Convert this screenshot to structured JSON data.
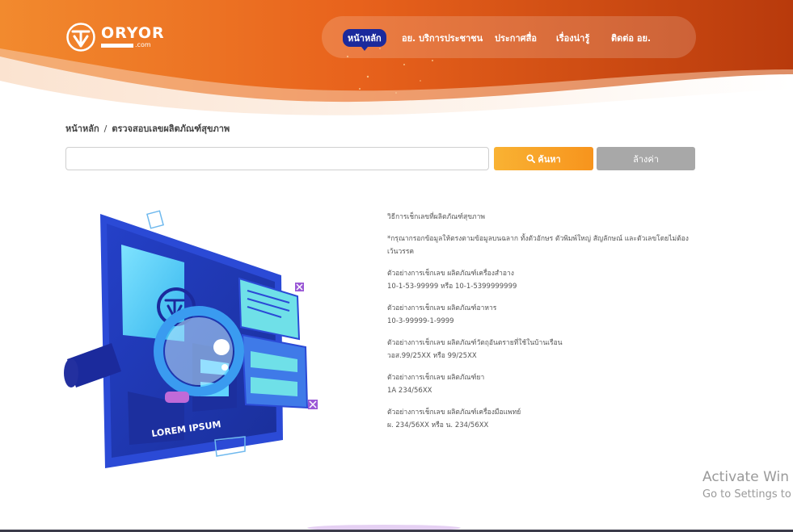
{
  "header": {
    "logo": {
      "name": "ORYOR",
      "sub": ".com",
      "icon": "fda-shield-icon"
    },
    "nav": [
      {
        "label": "หน้าหลัก",
        "active": true
      },
      {
        "label": "อย. บริการประชาชน",
        "active": false
      },
      {
        "label": "ประกาศสื่อ",
        "active": false
      },
      {
        "label": "เรื่องน่ารู้",
        "active": false
      },
      {
        "label": "ติดต่อ อย.",
        "active": false
      }
    ]
  },
  "breadcrumb": {
    "home": "หน้าหลัก",
    "separator": "/",
    "current": "ตรวจสอบเลขผลิตภัณฑ์สุขภาพ"
  },
  "search": {
    "value": "",
    "placeholder": "",
    "search_label": "ค้นหา",
    "search_icon": "search-icon",
    "clear_label": "ล้างค่า"
  },
  "illustration": {
    "caption": "LOREM IPSUM"
  },
  "instructions": {
    "title": "วิธีการเช็กเลขที่ผลิตภัณฑ์สุขภาพ",
    "note": "*กรุณากรอกข้อมูลให้ตรงตามข้อมูลบนฉลาก ทั้งตัวอักษร ตัวพิมพ์ใหญ่ สัญลักษณ์ และตัวเลขโดยไม่ต้องเว้นวรรค",
    "examples": [
      {
        "label": "ตัวอย่างการเช็กเลข ผลิตภัณฑ์เครื่องสำอาง",
        "value": "10-1-53-99999 หรือ 10-1-5399999999"
      },
      {
        "label": "ตัวอย่างการเช็กเลข ผลิตภัณฑ์อาหาร",
        "value": "10-3-99999-1-9999"
      },
      {
        "label": "ตัวอย่างการเช็กเลข ผลิตภัณฑ์วัตถุอันตรายที่ใช้ในบ้านเรือน",
        "value": "วอส.99/25XX หรือ 99/25XX"
      },
      {
        "label": "ตัวอย่างการเช็กเลข ผลิตภัณฑ์ยา",
        "value": "1A 234/56XX"
      },
      {
        "label": "ตัวอย่างการเช็กเลข ผลิตภัณฑ์เครื่องมือแพทย์",
        "value": "ผ. 234/56XX หรือ น. 234/56XX"
      }
    ]
  },
  "activation": {
    "line1": "Activate Win",
    "line2": "Go to Settings to"
  },
  "colors": {
    "header_orange": "#e8621c",
    "nav_active": "#1b2a9c",
    "search_button": "#f7941d",
    "clear_button": "#a8a8a8"
  }
}
